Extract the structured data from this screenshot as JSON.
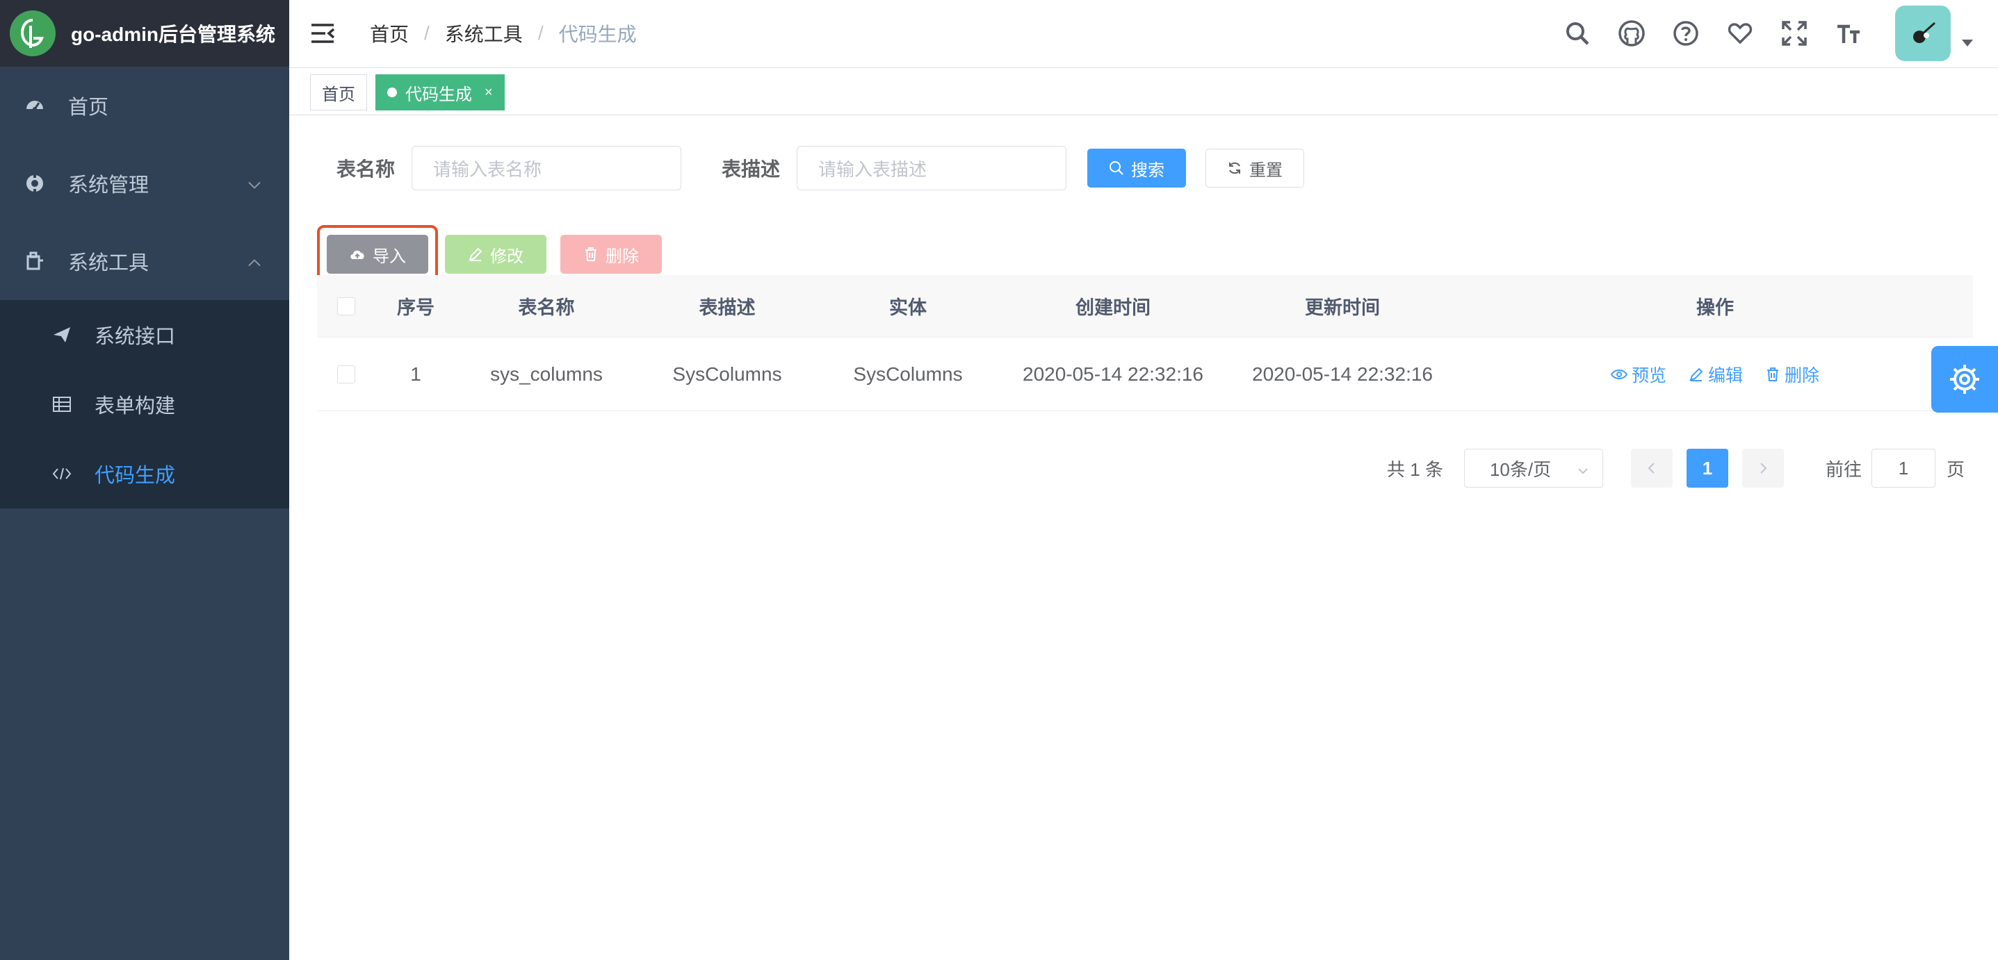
{
  "app": {
    "title": "go-admin后台管理系统",
    "logo_letter": "G"
  },
  "sidebar": {
    "items": [
      {
        "label": "首页",
        "icon": "dashboard-icon"
      },
      {
        "label": "系统管理",
        "icon": "settings-icon"
      },
      {
        "label": "系统工具",
        "icon": "tool-icon"
      }
    ],
    "tools_children": [
      {
        "label": "系统接口",
        "icon": "send-icon"
      },
      {
        "label": "表单构建",
        "icon": "table-icon"
      },
      {
        "label": "代码生成",
        "icon": "code-icon",
        "active": true
      }
    ]
  },
  "breadcrumb": [
    "首页",
    "系统工具",
    "代码生成"
  ],
  "tags": [
    {
      "label": "首页"
    },
    {
      "label": "代码生成",
      "active": true,
      "close": "×"
    }
  ],
  "search": {
    "table_name_label": "表名称",
    "table_name_placeholder": "请输入表名称",
    "table_desc_label": "表描述",
    "table_desc_placeholder": "请输入表描述",
    "search_button": "搜索",
    "reset_button": "重置"
  },
  "toolbar": {
    "import": "导入",
    "edit": "修改",
    "delete": "删除"
  },
  "table": {
    "headers": [
      "序号",
      "表名称",
      "表描述",
      "实体",
      "创建时间",
      "更新时间",
      "操作"
    ],
    "rows": [
      {
        "seq": "1",
        "name": "sys_columns",
        "desc": "SysColumns",
        "entity": "SysColumns",
        "created": "2020-05-14 22:32:16",
        "updated": "2020-05-14 22:32:16",
        "ops": {
          "preview": "预览",
          "edit": "编辑",
          "delete": "删除"
        }
      }
    ]
  },
  "pagination": {
    "total": "共 1 条",
    "page_size": "10条/页",
    "current": "1",
    "goto_label": "前往",
    "goto_value": "1",
    "goto_suffix": "页"
  },
  "colors": {
    "sidebar_bg": "#304156",
    "primary": "#409eff",
    "tag_active": "#42b983",
    "highlight_border": "#e4512a"
  }
}
